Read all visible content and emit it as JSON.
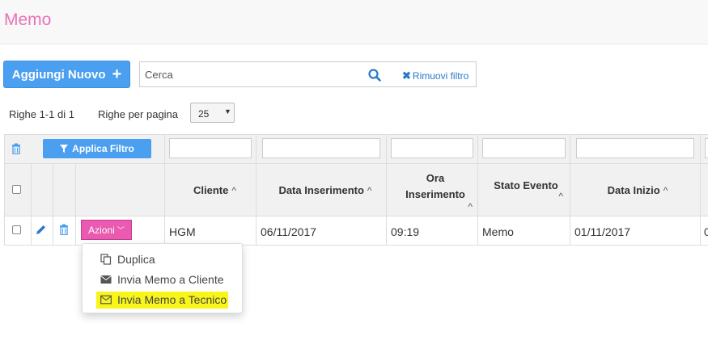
{
  "header": {
    "title": "Memo"
  },
  "toolbar": {
    "add_label": "Aggiungi Nuovo",
    "search_value": "Cerca",
    "remove_filter_label": "Rimuovi filtro"
  },
  "pagination": {
    "rows_info": "Righe 1-1 di 1",
    "rows_per_page_label": "Righe per pagina",
    "rows_per_page_value": "25"
  },
  "table": {
    "apply_filter_label": "Applica Filtro",
    "columns": {
      "cliente": "Cliente",
      "data_inserimento": "Data Inserimento",
      "ora_inserimento_line1": "Ora",
      "ora_inserimento_line2": "Inserimento",
      "stato_evento": "Stato Evento",
      "data_inizio": "Data Inizio"
    },
    "row": {
      "actions_label": "Azioni",
      "cliente": "HGM",
      "data_inserimento": "06/11/2017",
      "ora_inserimento": "09:19",
      "stato_evento": "Memo",
      "data_inizio": "01/11/2017",
      "overflow": "0"
    }
  },
  "dropdown": {
    "items": [
      {
        "label": "Duplica",
        "icon": "copy-icon"
      },
      {
        "label": "Invia Memo a Cliente",
        "icon": "envelope-icon"
      },
      {
        "label": "Invia Memo a Tecnico",
        "icon": "envelope-outline-icon"
      }
    ]
  },
  "colors": {
    "accent": "#e773b7",
    "primary": "#4a9ff0",
    "highlight": "#f8f519"
  }
}
